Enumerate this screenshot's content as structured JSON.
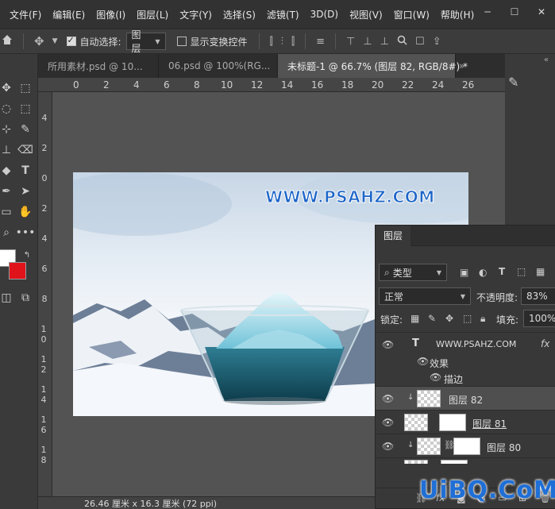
{
  "menu": [
    "文件(F)",
    "编辑(E)",
    "图像(I)",
    "图层(L)",
    "文字(Y)",
    "选择(S)",
    "滤镜(T)",
    "3D(D)",
    "视图(V)",
    "窗口(W)",
    "帮助(H)"
  ],
  "window_controls": {
    "minimize": "─",
    "maximize": "☐",
    "close": "✕"
  },
  "options": {
    "auto_select_label": "自动选择:",
    "auto_select_value": "图层",
    "show_transform_label": "显示变换控件"
  },
  "tabs": [
    {
      "label": "所用素材.psd @ 10...",
      "active": false
    },
    {
      "label": "06.psd @ 100%(RG...",
      "active": false
    },
    {
      "label": "未标题-1 @ 66.7% (图层 82, RGB/8#) *",
      "active": true
    }
  ],
  "ruler_top": [
    "0",
    "2",
    "4",
    "6",
    "8",
    "10",
    "12",
    "14",
    "16",
    "18",
    "20",
    "22",
    "24",
    "26"
  ],
  "ruler_left": [
    "4",
    "2",
    "0",
    "2",
    "4",
    "6",
    "8",
    "1 0",
    "1 2",
    "1 4",
    "1 6",
    "1 8"
  ],
  "canvas": {
    "watermark_text": "WWW.PSAHZ.COM"
  },
  "status": {
    "doc_size": "26.46 厘米 x 16.3 厘米 (72 ppi)"
  },
  "layers_panel": {
    "title": "图层",
    "filter_type": "类型",
    "blend_mode": "正常",
    "opacity_label": "不透明度:",
    "opacity_value": "83%",
    "lock_label": "锁定:",
    "fill_label": "填充:",
    "fill_value": "100%",
    "text_layer_name": "WWW.PSAHZ.COM",
    "fx_label": "fx",
    "effects_label": "效果",
    "stroke_label": "描边",
    "layers": [
      {
        "name": "图层 82"
      },
      {
        "name": "图层 81"
      },
      {
        "name": "图层 80"
      }
    ]
  },
  "site_watermark": "UiBQ.CoM"
}
